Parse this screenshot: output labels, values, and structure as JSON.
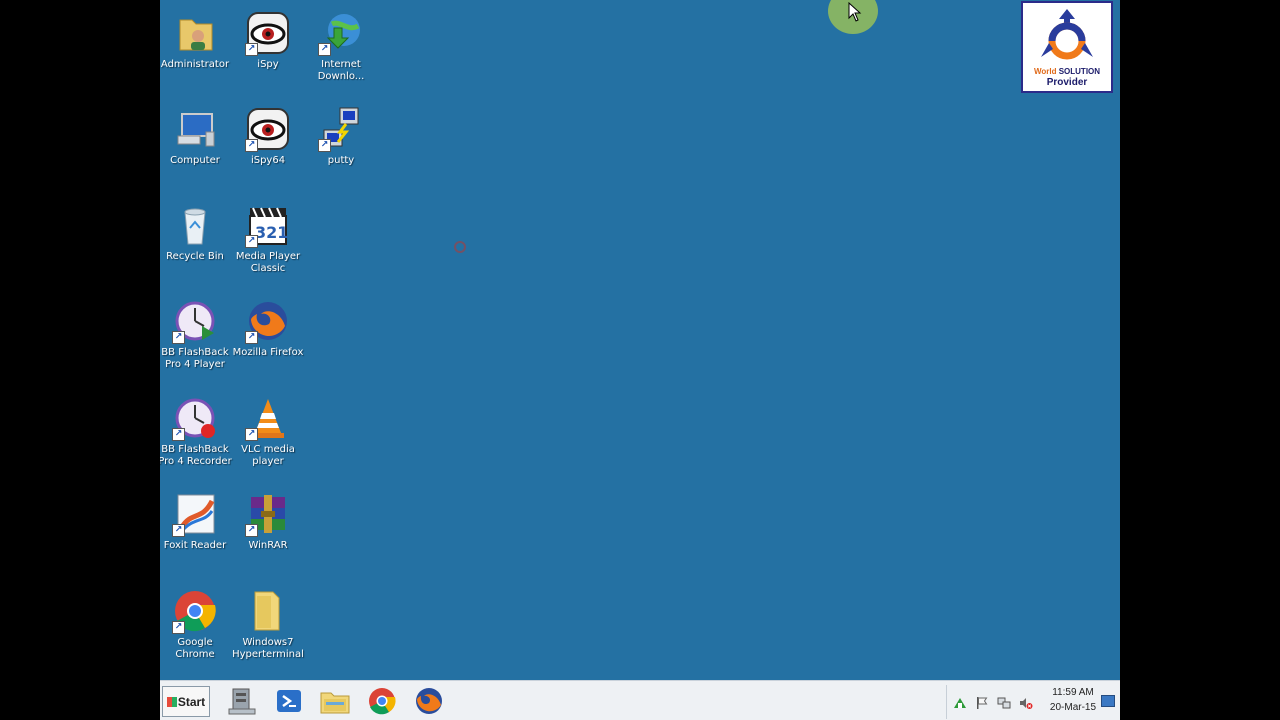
{
  "desktop": {
    "icons": [
      {
        "label": "Administrator",
        "icon": "user-folder-icon"
      },
      {
        "label": "iSpy",
        "icon": "ispy-eye-icon"
      },
      {
        "label": "Internet\nDownlo...",
        "icon": "internet-download-manager-icon"
      },
      {
        "label": "Computer",
        "icon": "computer-icon"
      },
      {
        "label": "iSpy64",
        "icon": "ispy-eye-icon"
      },
      {
        "label": "putty",
        "icon": "putty-icon"
      },
      {
        "label": "Recycle Bin",
        "icon": "recycle-bin-icon"
      },
      {
        "label": "Media Player\nClassic",
        "icon": "media-player-classic-icon"
      },
      {
        "label": "BB FlashBack\nPro 4 Player",
        "icon": "flashback-player-icon"
      },
      {
        "label": "Mozilla Firefox",
        "icon": "firefox-icon"
      },
      {
        "label": "BB FlashBack\nPro 4 Recorder",
        "icon": "flashback-recorder-icon"
      },
      {
        "label": "VLC media\nplayer",
        "icon": "vlc-icon"
      },
      {
        "label": "Foxit Reader",
        "icon": "foxit-reader-icon"
      },
      {
        "label": "WinRAR",
        "icon": "winrar-icon"
      },
      {
        "label": "Google Chrome",
        "icon": "chrome-icon"
      },
      {
        "label": "Windows7\nHyperterminal",
        "icon": "folder-icon"
      }
    ]
  },
  "watermark": {
    "line1_world": "World",
    "line1_solution": "SOLUTION",
    "line2": "Provider"
  },
  "taskbar": {
    "start_label": "Start",
    "pinned": [
      "server-manager-icon",
      "powershell-icon",
      "explorer-icon",
      "chrome-icon",
      "firefox-icon"
    ],
    "tray_icons": [
      "network-icon",
      "action-center-flag-icon",
      "network-lan-icon",
      "volume-muted-icon"
    ],
    "clock_time": "11:59 AM",
    "clock_date": "20-Mar-15"
  },
  "colors": {
    "desktop_bg": "#2471a3",
    "taskbar_bg": "#eef1f4"
  }
}
